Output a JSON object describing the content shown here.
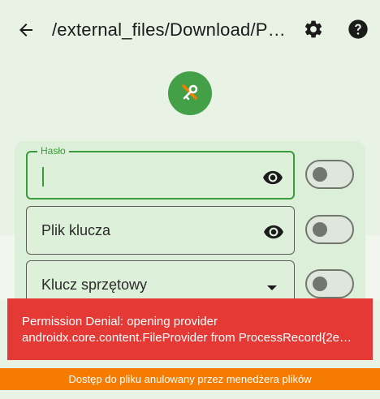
{
  "appbar": {
    "path_title": "/external_files/Download/Pass…"
  },
  "fields": [
    {
      "label": "Hasło",
      "value": "",
      "focused": true,
      "icon": "eye-icon"
    },
    {
      "label": "Plik klucza",
      "value": "Plik klucza",
      "focused": false,
      "icon": "eye-icon"
    },
    {
      "label": "Klucz sprzętowy",
      "value": "Klucz sprzętowy",
      "focused": false,
      "icon": "chevron-down-icon"
    }
  ],
  "toggles": [
    {
      "name": "password-toggle",
      "on": false
    },
    {
      "name": "keyfile-toggle",
      "on": false
    },
    {
      "name": "hardware-key-toggle",
      "on": false
    }
  ],
  "error": {
    "line1": "Permission Denial: opening provider",
    "line2": "androidx.core.content.FileProvider from ProcessRecord{2e7…"
  },
  "banner": {
    "text": "Dostęp do pliku anulowany przez menedżera plików"
  },
  "colors": {
    "accent": "#43a047",
    "error": "#e53935",
    "banner": "#f57c00"
  }
}
